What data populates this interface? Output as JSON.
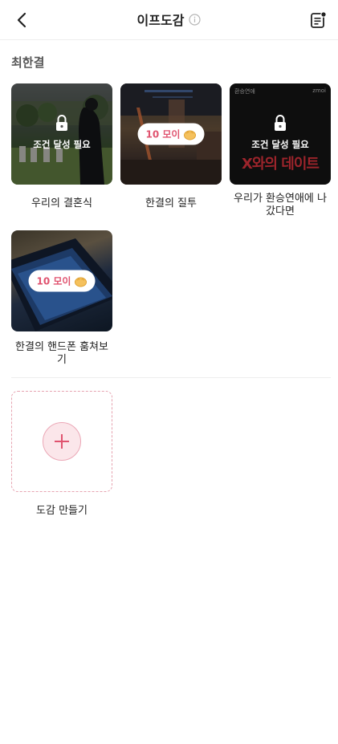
{
  "header": {
    "title": "이프도감"
  },
  "section": {
    "title": "최한결"
  },
  "cards": [
    {
      "caption": "우리의 결혼식",
      "locked": true,
      "lock_text": "조건 달성 필요"
    },
    {
      "caption": "한결의 질투",
      "locked": false,
      "pill_text": "10 모이"
    },
    {
      "caption": "우리가 환승연애에 나갔다면",
      "locked": true,
      "lock_text": "조건 달성 필요",
      "thumb_top_left": "환승연애",
      "thumb_top_right": "zmoi",
      "thumb_title": "X와의 데이트"
    },
    {
      "caption": "한결의 핸드폰 훔쳐보기",
      "locked": false,
      "pill_text": "10 모이"
    }
  ],
  "create": {
    "label": "도감 만들기"
  },
  "colors": {
    "accent": "#e0536f",
    "create_border": "#e6a3b0",
    "plus_bg": "#fbe6ea"
  },
  "icons": [
    "back-arrow-icon",
    "info-icon",
    "note-list-icon",
    "lock-icon",
    "coin-icon",
    "plus-icon"
  ]
}
